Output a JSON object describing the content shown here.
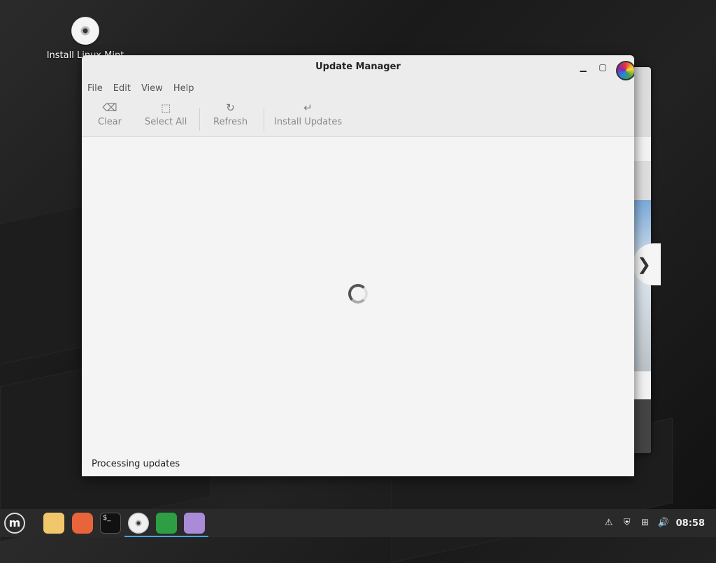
{
  "desktop": {
    "icons": [
      {
        "label": "Install Linux Mint",
        "icon": "disc-icon"
      }
    ]
  },
  "window": {
    "title": "Update Manager",
    "menu": [
      "File",
      "Edit",
      "View",
      "Help"
    ],
    "toolbar": {
      "clear": "Clear",
      "select_all": "Select All",
      "refresh": "Refresh",
      "install_updates": "Install Updates"
    },
    "status": "Processing updates"
  },
  "taskbar": {
    "apps": [
      "files-icon",
      "firefox-icon",
      "terminal-icon",
      "disc-icon",
      "shield-icon",
      "transfer-icon"
    ],
    "clock": "08:58"
  },
  "colors": {
    "accent": "#4aa3df",
    "titlebar": "#ececec",
    "taskbar": "#2a2a2a"
  }
}
